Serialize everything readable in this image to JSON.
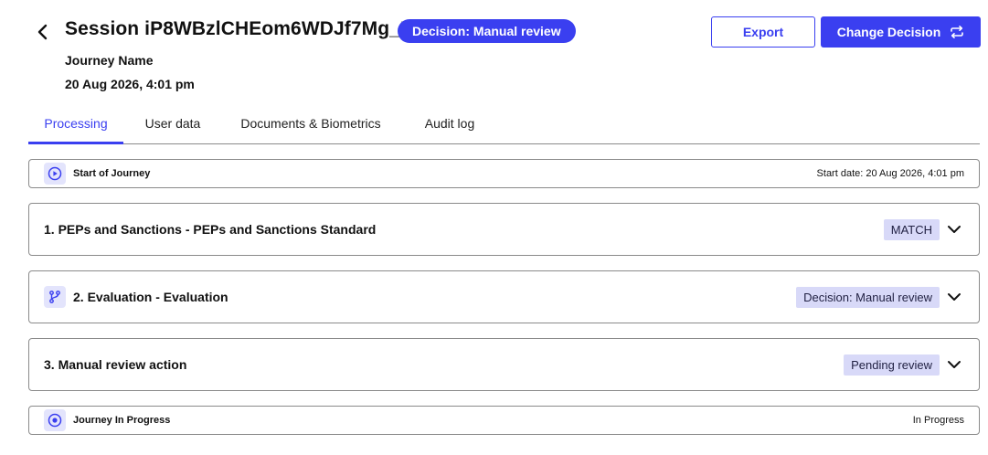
{
  "header": {
    "title": "Session iP8WBzlCHEom6WDJf7Mg_R",
    "decision_badge": "Decision: Manual review",
    "journey_name": "Journey Name",
    "date": "20 Aug 2026, 4:01 pm",
    "export_label": "Export",
    "change_decision_label": "Change Decision"
  },
  "tabs": [
    {
      "label": "Processing",
      "active": true
    },
    {
      "label": "User data",
      "active": false
    },
    {
      "label": "Documents & Biometrics",
      "active": false
    },
    {
      "label": "Audit log",
      "active": false
    }
  ],
  "timeline": {
    "start": {
      "label": "Start of Journey",
      "right_text": "Start date: 20 Aug 2026, 4:01 pm",
      "icon": "play-circle-icon"
    },
    "steps": [
      {
        "label": "1. PEPs and Sanctions - PEPs and Sanctions Standard",
        "status": "MATCH",
        "icon": null
      },
      {
        "label": "2. Evaluation - Evaluation",
        "status": "Decision: Manual review",
        "icon": "branch-icon"
      },
      {
        "label": "3. Manual review action",
        "status": "Pending review",
        "icon": null
      }
    ],
    "end": {
      "label": "Journey In Progress",
      "right_text": "In Progress",
      "icon": "target-circle-icon"
    }
  },
  "colors": {
    "accent": "#3a3ff0",
    "tag_background": "#d8d9f8",
    "icon_background": "#e3e4fc",
    "border": "#8a8a8a"
  }
}
